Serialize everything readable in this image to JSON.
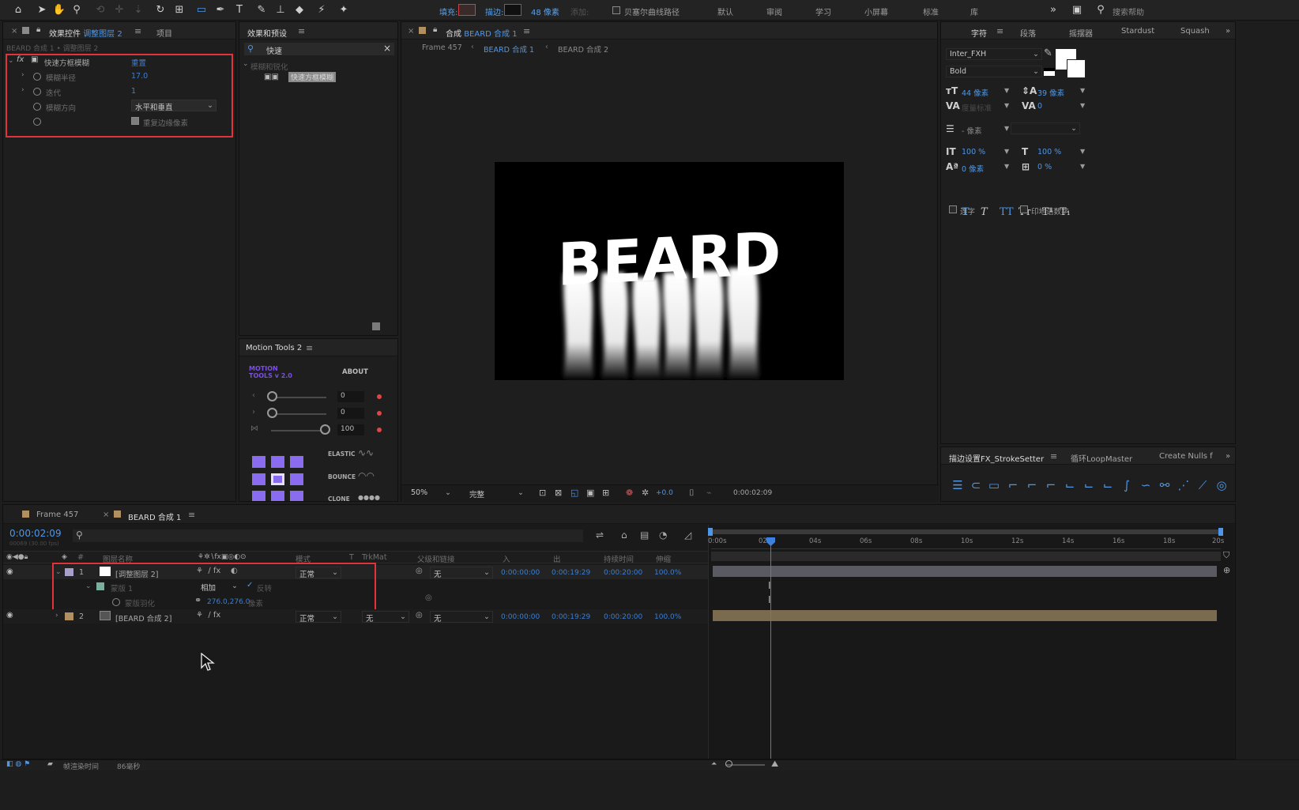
{
  "toolbar": {
    "fill_label": "填充:",
    "stroke_label": "描边:",
    "stroke_width": "48 像素",
    "add_label": "添加:",
    "bezier_label": "贝塞尔曲线路径",
    "workspaces": [
      "默认",
      "审阅",
      "学习",
      "小屏幕",
      "标准",
      "库"
    ],
    "search_placeholder": "搜索帮助"
  },
  "effect_controls": {
    "tab_label": "效果控件",
    "tab_layer": "调整图层 2",
    "tab_project": "项目",
    "breadcrumb": "BEARD 合成 1 • 调整图层 2",
    "effect_name": "快速方框模糊",
    "reset": "重置",
    "props": [
      {
        "label": "模糊半径",
        "value": "17.0"
      },
      {
        "label": "迭代",
        "value": "1"
      },
      {
        "label": "模糊方向",
        "value": "水平和垂直"
      },
      {
        "label": "",
        "value": "重复边缘像素"
      }
    ]
  },
  "effects_presets": {
    "tab_label": "效果和预设",
    "search_value": "快速",
    "category": "模糊和锐化",
    "item": "快速方框模糊"
  },
  "motion_tools": {
    "tab_label": "Motion Tools 2",
    "logo_line1": "MOTION",
    "logo_line2": "TOOLS v 2.0",
    "about": "ABOUT",
    "values": [
      "0",
      "0",
      "100"
    ],
    "elastic": "ELASTIC",
    "bounce": "BOUNCE",
    "clone": "CLONE"
  },
  "composition": {
    "tab_label": "合成",
    "tab_comp": "BEARD 合成 1",
    "breadcrumbs": [
      "Frame 457",
      "BEARD 合成 1",
      "BEARD 合成 2"
    ],
    "preview_text": "BEARD",
    "zoom": "50%",
    "quality": "完整",
    "exposure": "+0.0",
    "timecode": "0:00:02:09"
  },
  "character": {
    "tabs": [
      "字符",
      "段落",
      "摇摆器",
      "Stardust",
      "Squash"
    ],
    "font": "Inter_FXH",
    "style": "Bold",
    "font_size": "44 像素",
    "leading": "39 像素",
    "kerning": "度量标准",
    "tracking": "0",
    "stroke_width": "- 像素",
    "vscale": "100 %",
    "hscale": "100 %",
    "baseline": "0 像素",
    "tsume": "0 %",
    "ligature": "连字",
    "hindi": "印地语数字",
    "style_buttons": [
      "T",
      "T",
      "TT",
      "Tт",
      "T¹",
      "T₁"
    ]
  },
  "stroke_setter": {
    "tabs": [
      "描边设置FX_StrokeSetter",
      "循环LoopMaster",
      "Create Nulls f"
    ]
  },
  "timeline": {
    "tabs": [
      "Frame 457",
      "BEARD 合成 1"
    ],
    "timecode": "0:00:02:09",
    "frame_info": "00069 (30.00 fps)",
    "headers": [
      "#",
      "图层名称",
      "模式",
      "T",
      "TrkMat",
      "父级和链接",
      "入",
      "出",
      "持续时间",
      "伸缩"
    ],
    "layers": [
      {
        "num": "1",
        "name": "[调整图层 2]",
        "mode": "正常",
        "parent": "无",
        "in": "0:00:00:00",
        "out": "0:00:19:29",
        "dur": "0:00:20:00",
        "stretch": "100.0%"
      },
      {
        "num": "2",
        "name": "[BEARD 合成 2]",
        "mode": "正常",
        "trkmat": "无",
        "parent": "无",
        "in": "0:00:00:00",
        "out": "0:00:19:29",
        "dur": "0:00:20:00",
        "stretch": "100.0%"
      }
    ],
    "mask_name": "蒙版 1",
    "mask_mode": "相加",
    "mask_invert": "反转",
    "mask_feather_label": "蒙版羽化",
    "mask_feather_value": "276.0,276.0",
    "mask_feather_unit": "像素",
    "ruler": [
      "0:00s",
      "02s",
      "04s",
      "06s",
      "08s",
      "10s",
      "12s",
      "14s",
      "16s",
      "18s",
      "20s"
    ],
    "render_time_label": "帧渲染时间",
    "render_time_value": "86毫秒"
  }
}
